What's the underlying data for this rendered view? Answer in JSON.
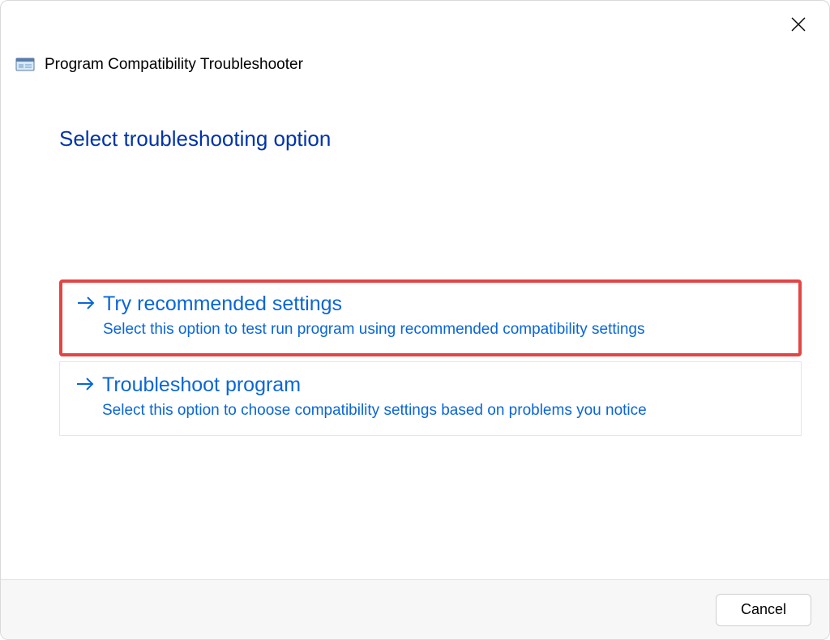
{
  "window": {
    "title": "Program Compatibility Troubleshooter"
  },
  "instruction": "Select troubleshooting option",
  "options": [
    {
      "title": "Try recommended settings",
      "description": "Select this option to test run program using recommended compatibility settings",
      "highlighted": true
    },
    {
      "title": "Troubleshoot program",
      "description": "Select this option to choose compatibility settings based on problems you notice",
      "highlighted": false
    }
  ],
  "footer": {
    "cancel": "Cancel"
  }
}
